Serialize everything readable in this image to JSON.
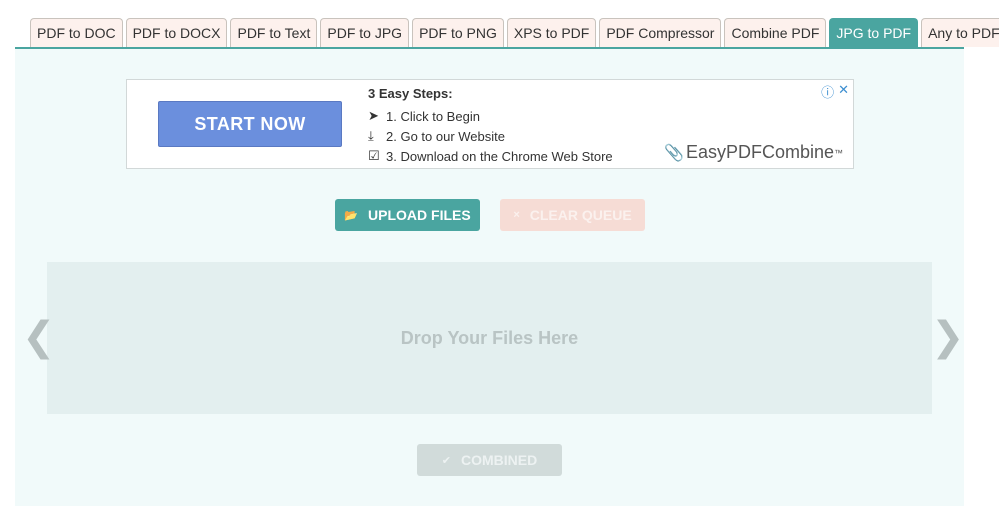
{
  "tabs": [
    {
      "label": "PDF to DOC",
      "active": false
    },
    {
      "label": "PDF to DOCX",
      "active": false
    },
    {
      "label": "PDF to Text",
      "active": false
    },
    {
      "label": "PDF to JPG",
      "active": false
    },
    {
      "label": "PDF to PNG",
      "active": false
    },
    {
      "label": "XPS to PDF",
      "active": false
    },
    {
      "label": "PDF Compressor",
      "active": false
    },
    {
      "label": "Combine PDF",
      "active": false
    },
    {
      "label": "JPG to PDF",
      "active": true
    },
    {
      "label": "Any to PDF",
      "active": false
    }
  ],
  "ad": {
    "start_label": "START NOW",
    "steps_heading": "3 Easy Steps:",
    "steps": [
      {
        "icon": "cursor-icon",
        "glyph": "➤",
        "text": "1. Click to Begin"
      },
      {
        "icon": "download-arrow-icon",
        "glyph": "⤓",
        "text": "2. Go to our Website"
      },
      {
        "icon": "checkbox-icon",
        "glyph": "☑",
        "text": "3. Download on the Chrome Web Store"
      }
    ],
    "info_glyph": "ⓘ",
    "close_glyph": "✕",
    "brand": "EasyPDFCombine",
    "brand_tm": "™"
  },
  "actions": {
    "upload_label": "UPLOAD FILES",
    "upload_icon": "📂",
    "clear_label": "CLEAR QUEUE",
    "clear_icon": "×",
    "combined_label": "COMBINED",
    "combined_icon": "✔"
  },
  "dropzone": {
    "text": "Drop Your Files Here"
  },
  "nav": {
    "prev_glyph": "❮",
    "next_glyph": "❯"
  },
  "colors": {
    "accent": "#4aa5a0",
    "tab_bg": "#fdf1ed",
    "panel_bg": "#f1fafa"
  }
}
